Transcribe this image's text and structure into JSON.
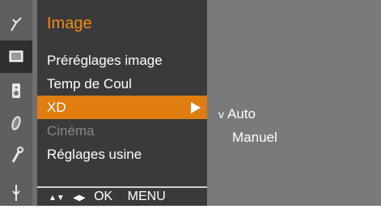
{
  "menu": {
    "title": "Image",
    "items": [
      {
        "label": "Préréglages image"
      },
      {
        "label": "Temp de Coul"
      },
      {
        "label": "XD"
      },
      {
        "label": "Cinéma"
      },
      {
        "label": "Réglages usine"
      }
    ],
    "hint": {
      "updown": "▲▼",
      "leftright": "◀▶",
      "ok": "OK",
      "menu": "MENU"
    }
  },
  "submenu": {
    "items": [
      {
        "label": "Auto",
        "checked": true,
        "mark": "v"
      },
      {
        "label": "Manuel",
        "checked": false
      }
    ]
  },
  "colors": {
    "accent": "#e07d10",
    "title": "#f08a18",
    "panel": "#3a3a3a"
  },
  "icons": [
    "antenna-icon",
    "picture-icon",
    "speaker-icon",
    "clock-icon",
    "key-icon",
    "settings-icon"
  ]
}
